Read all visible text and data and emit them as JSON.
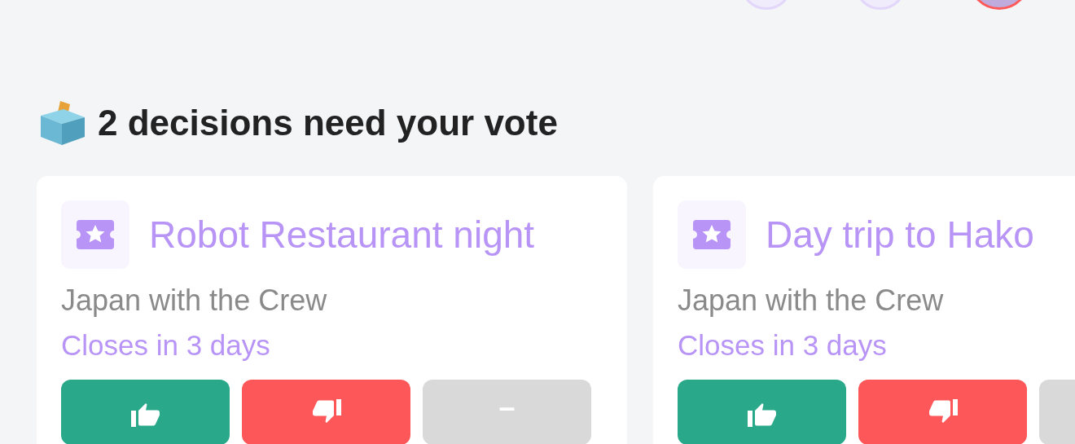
{
  "members": [
    {
      "kind": "member"
    },
    {
      "kind": "member"
    },
    {
      "kind": "current"
    }
  ],
  "heading": "2 decisions need your vote",
  "decisions": [
    {
      "title": "Robot Restaurant night",
      "group": "Japan with the Crew",
      "deadline": "Closes in 3 days",
      "abstain_label": "–"
    },
    {
      "title": "Day trip to Hako",
      "group": "Japan with the Crew",
      "deadline": "Closes in 3 days"
    }
  ]
}
